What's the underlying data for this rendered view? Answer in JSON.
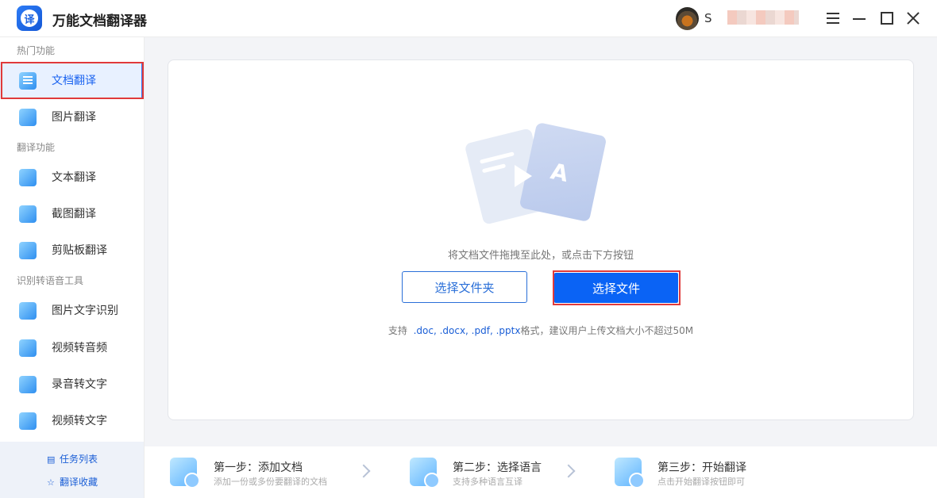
{
  "app": {
    "title": "万能文档翻译器",
    "logo_char": "译"
  },
  "user": {
    "name": "S"
  },
  "sidebar": {
    "sections": [
      {
        "title": "热门功能",
        "items": [
          {
            "label": "文档翻译",
            "active": true
          },
          {
            "label": "图片翻译"
          }
        ]
      },
      {
        "title": "翻译功能",
        "items": [
          {
            "label": "文本翻译"
          },
          {
            "label": "截图翻译"
          },
          {
            "label": "剪贴板翻译"
          }
        ]
      },
      {
        "title": "识别转语音工具",
        "items": [
          {
            "label": "图片文字识别"
          },
          {
            "label": "视频转音频"
          },
          {
            "label": "录音转文字"
          },
          {
            "label": "视频转文字"
          }
        ]
      }
    ],
    "bottom_links": [
      {
        "label": "任务列表",
        "icon": "list-icon"
      },
      {
        "label": "翻译收藏",
        "icon": "star-icon"
      }
    ]
  },
  "upload": {
    "illustration_letter": "A",
    "drop_hint": "将文档文件拖拽至此处，或点击下方按钮",
    "select_folder_label": "选择文件夹",
    "select_file_label": "选择文件",
    "formats_prefix": "支持",
    "formats_list": ".doc, .docx, .pdf, .pptx",
    "formats_suffix": "格式，建议用户上传文档大小不超过50M"
  },
  "steps": [
    {
      "title": "第一步：添加文档",
      "subtitle": "添加一份或多份要翻译的文档"
    },
    {
      "title": "第二步：选择语言",
      "subtitle": "支持多种语言互译"
    },
    {
      "title": "第三步：开始翻译",
      "subtitle": "点击开始翻译按钮即可"
    }
  ],
  "colors": {
    "accent": "#0a63f5",
    "highlight_border": "#e03a3a",
    "active_bg": "#e8f1ff"
  }
}
